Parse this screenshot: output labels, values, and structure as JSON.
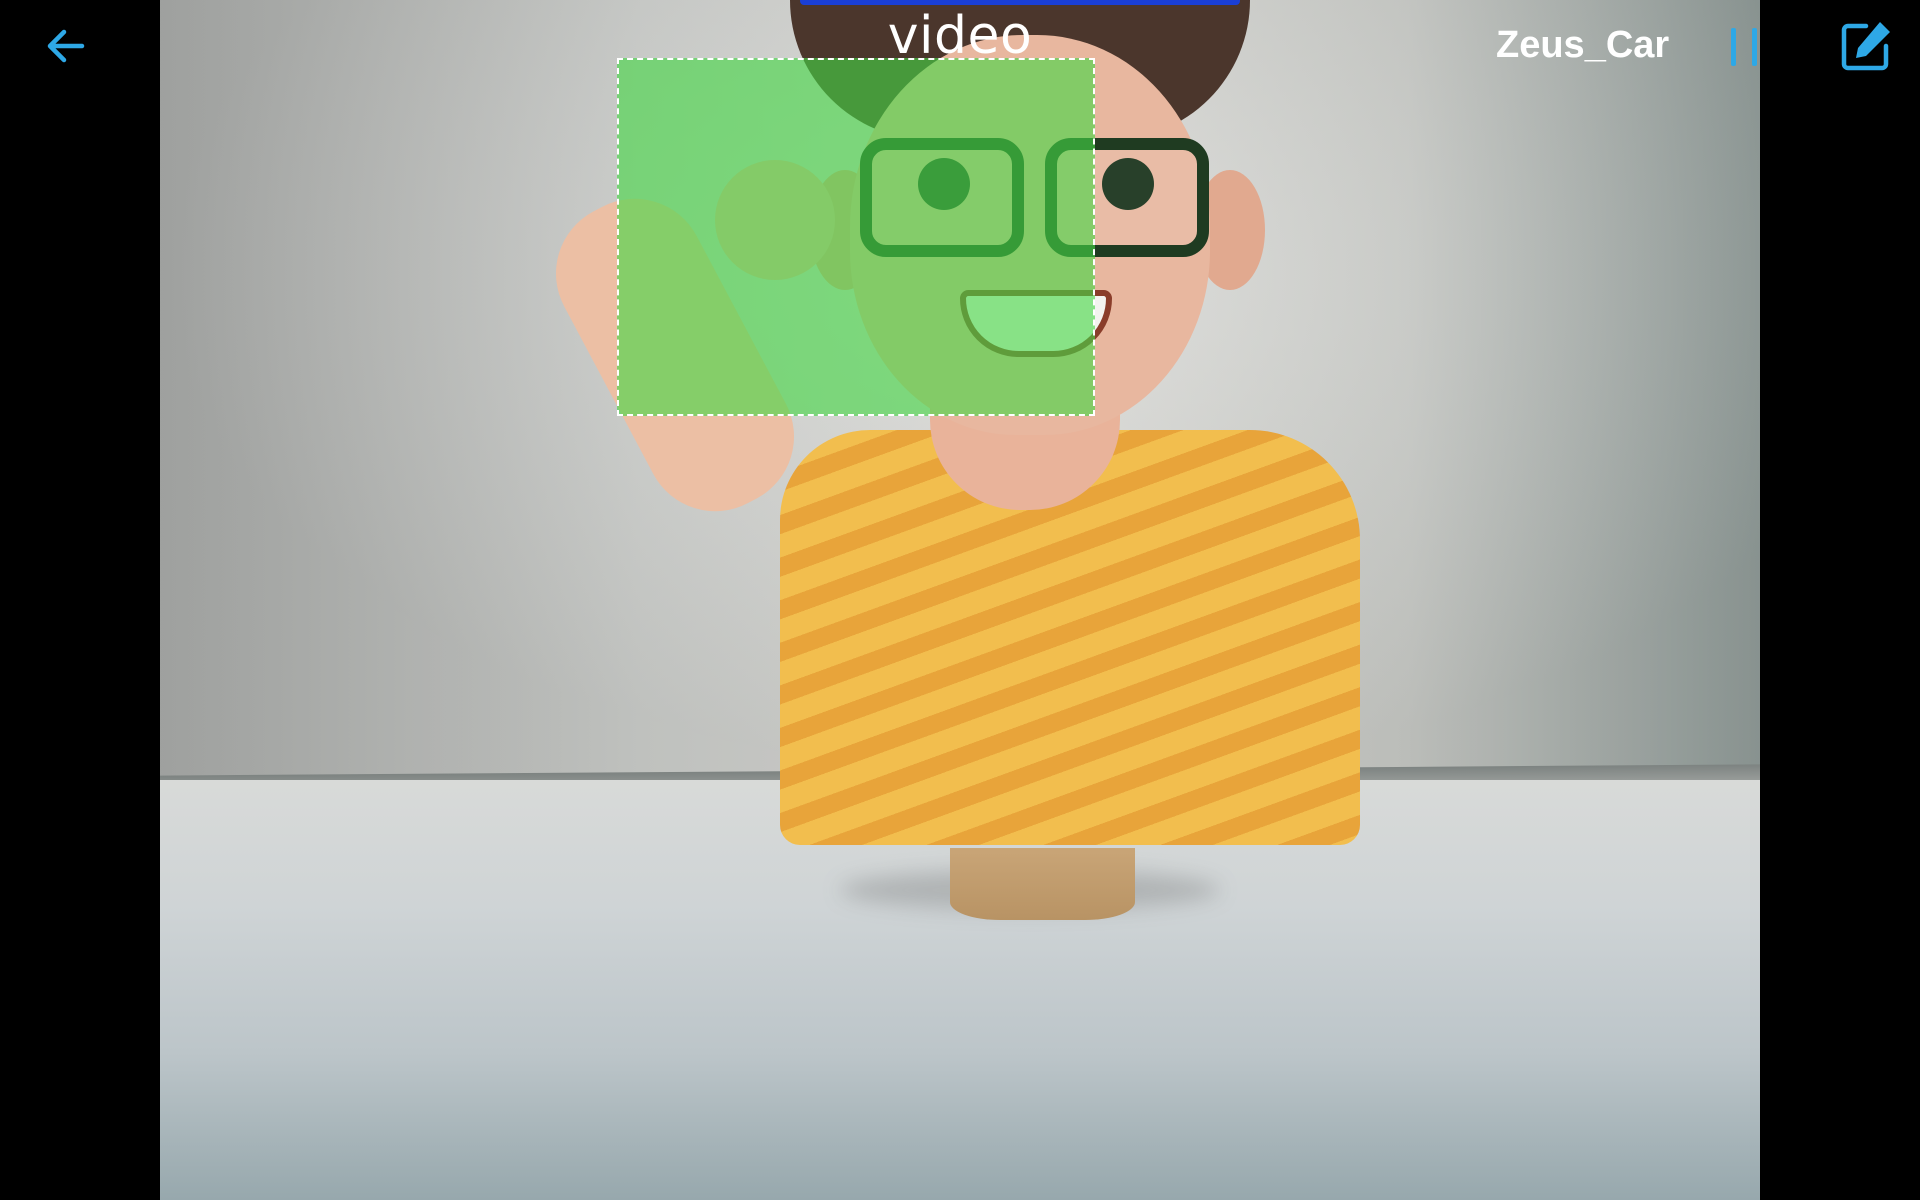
{
  "header": {
    "video_label": "video",
    "device_name": "Zeus_Car"
  },
  "icons": {
    "back": "arrow-left-icon",
    "pause": "pause-icon",
    "edit": "edit-icon"
  },
  "colors": {
    "accent": "#2ea8e6",
    "face_box_fill": "#46d746",
    "face_box_border": "#ffffff"
  },
  "video": {
    "detection": "face-box"
  }
}
